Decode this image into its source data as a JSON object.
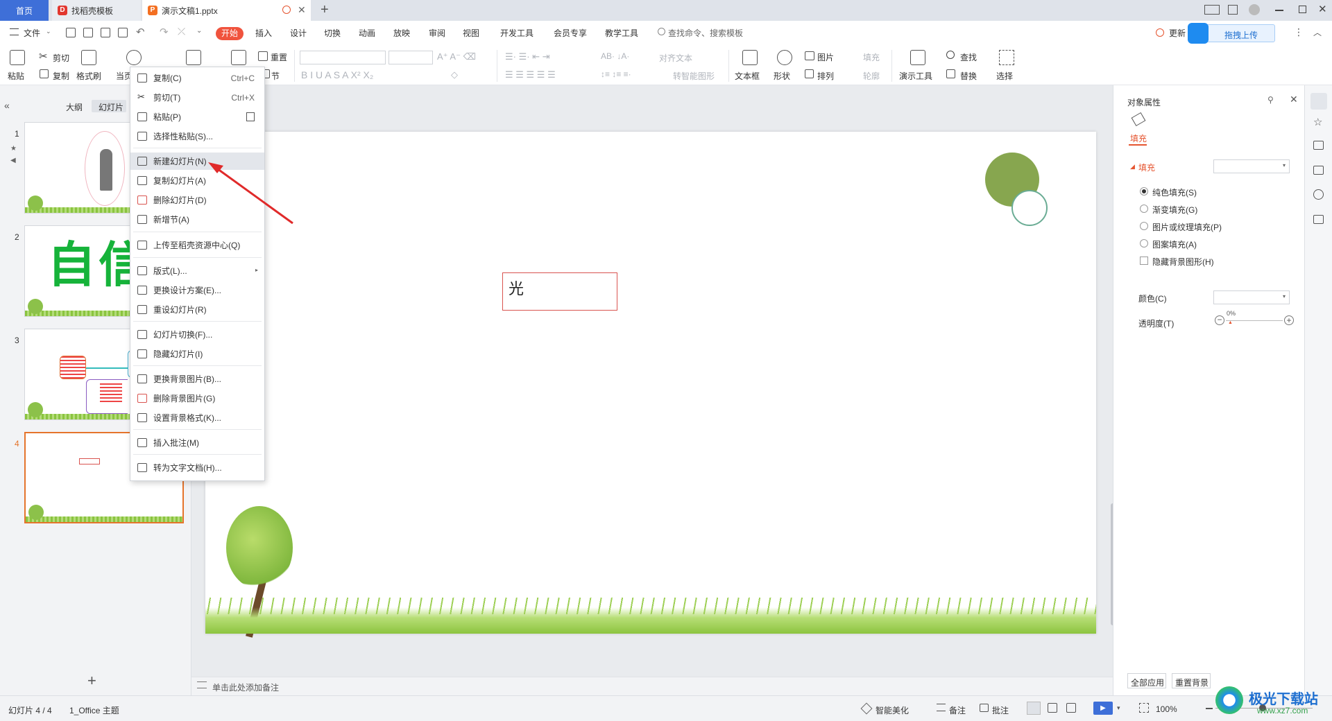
{
  "tabs": {
    "home": "首页",
    "template": "找稻壳模板",
    "doc": "演示文稿1.pptx"
  },
  "menubar": {
    "file": "文件",
    "items": [
      "开始",
      "插入",
      "设计",
      "切换",
      "动画",
      "放映",
      "审阅",
      "视图",
      "开发工具",
      "会员专享",
      "教学工具"
    ],
    "search_placeholder": "查找命令、搜索模板",
    "update": "更新",
    "upload": "拖拽上传"
  },
  "ribbon": {
    "paste": "粘贴",
    "cut": "剪切",
    "copy": "复制",
    "format_painter": "格式刷",
    "current": "当页",
    "reset": "重置",
    "section": "节",
    "align_text": "对齐文本",
    "to_smartart": "转智能图形",
    "textbox": "文本框",
    "shape": "形状",
    "picture": "图片",
    "arrange": "排列",
    "fill": "填充",
    "outline": "轮廓",
    "presenter_tools": "演示工具",
    "find": "查找",
    "replace": "替换",
    "select": "选择"
  },
  "left_panel": {
    "tab_outline": "大纲",
    "tab_slides": "幻灯片",
    "slide_numbers": [
      "1",
      "2",
      "3",
      "4"
    ],
    "slide2_text": "自信",
    "add_button": "+"
  },
  "context_menu": {
    "items": [
      {
        "label": "复制(C)",
        "shortcut": "Ctrl+C",
        "icon": "copy-icon"
      },
      {
        "label": "剪切(T)",
        "shortcut": "Ctrl+X",
        "icon": "scissors-icon"
      },
      {
        "label": "粘贴(P)",
        "shortcut": "",
        "icon": "paste-icon"
      },
      {
        "label": "选择性粘贴(S)...",
        "shortcut": "",
        "icon": "paste-special-icon"
      },
      {
        "label": "新建幻灯片(N)",
        "shortcut": "",
        "icon": "new-slide-icon"
      },
      {
        "label": "复制幻灯片(A)",
        "shortcut": "",
        "icon": "duplicate-slide-icon"
      },
      {
        "label": "删除幻灯片(D)",
        "shortcut": "",
        "icon": "delete-slide-icon"
      },
      {
        "label": "新增节(A)",
        "shortcut": "",
        "icon": "add-section-icon"
      },
      {
        "label": "上传至稻壳资源中心(Q)",
        "shortcut": "",
        "icon": "upload-icon"
      },
      {
        "label": "版式(L)...",
        "shortcut": "",
        "icon": "layout-icon"
      },
      {
        "label": "更换设计方案(E)...",
        "shortcut": "",
        "icon": "design-icon"
      },
      {
        "label": "重设幻灯片(R)",
        "shortcut": "",
        "icon": "reset-slide-icon"
      },
      {
        "label": "幻灯片切换(F)...",
        "shortcut": "",
        "icon": "transition-icon"
      },
      {
        "label": "隐藏幻灯片(I)",
        "shortcut": "",
        "icon": "hide-slide-icon"
      },
      {
        "label": "更换背景图片(B)...",
        "shortcut": "",
        "icon": "change-bg-icon"
      },
      {
        "label": "删除背景图片(G)",
        "shortcut": "",
        "icon": "delete-bg-icon"
      },
      {
        "label": "设置背景格式(K)...",
        "shortcut": "",
        "icon": "bg-format-icon"
      },
      {
        "label": "插入批注(M)",
        "shortcut": "",
        "icon": "comment-icon"
      },
      {
        "label": "转为文字文档(H)...",
        "shortcut": "",
        "icon": "convert-doc-icon"
      }
    ]
  },
  "slide": {
    "textbox_text": "光"
  },
  "notes": {
    "placeholder": "单击此处添加备注"
  },
  "right_panel": {
    "title": "对象属性",
    "fill_tab": "填充",
    "fill_section": "填充",
    "options": [
      "纯色填充(S)",
      "渐变填充(G)",
      "图片或纹理填充(P)",
      "图案填充(A)"
    ],
    "hide_bg": "隐藏背景图形(H)",
    "color_label": "颜色(C)",
    "transparency_label": "透明度(T)",
    "transparency_value": "0%",
    "apply_all": "全部应用",
    "reset_bg": "重置背景"
  },
  "statusbar": {
    "slide_info": "幻灯片 4 / 4",
    "theme": "1_Office 主题",
    "beautify": "智能美化",
    "notes": "备注",
    "comments": "批注",
    "zoom": "100%",
    "watermark": "极光下载站",
    "watermark_url": "www.xz7.com"
  },
  "colors": {
    "accent": "#f0533d",
    "tab_home": "#3e6fd8",
    "upload": "#1e8bf0",
    "circle_green": "#87a64f",
    "selection_red": "#d9534f"
  }
}
